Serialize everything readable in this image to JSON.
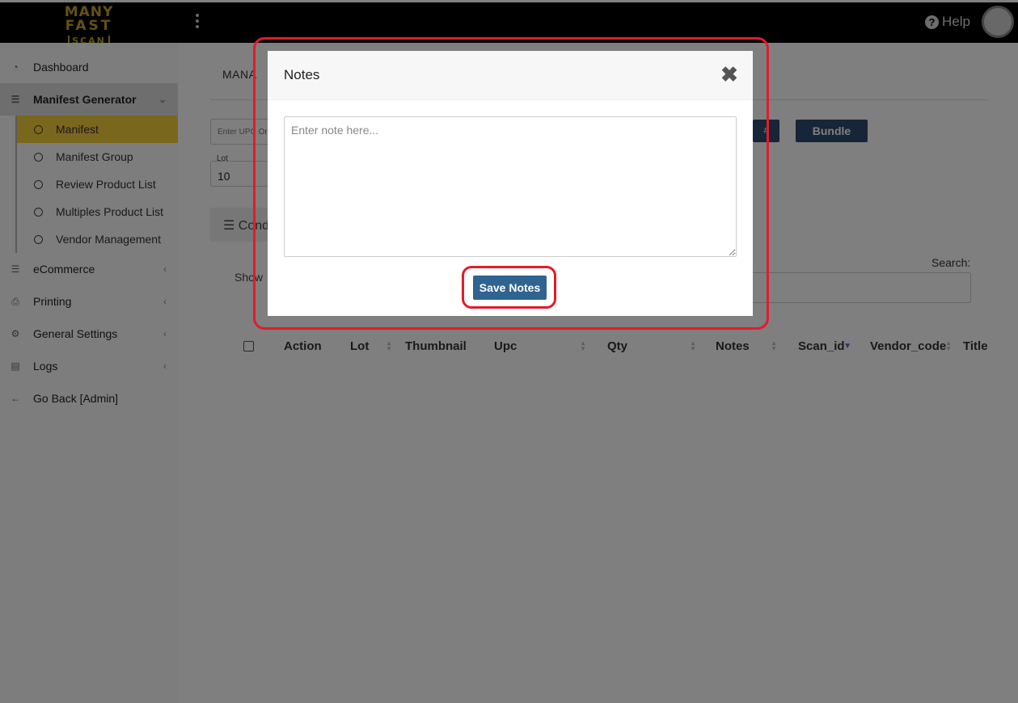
{
  "brand": {
    "line1": "MANY",
    "line2": "FAST",
    "line3": "SCAN"
  },
  "topbar": {
    "help_label": "Help"
  },
  "sidebar": {
    "items": [
      {
        "label": "Dashboard",
        "icon": "gauge-icon"
      },
      {
        "label": "Manifest Generator",
        "icon": "list-icon",
        "expanded": true
      },
      {
        "label": "eCommerce",
        "icon": "list-icon"
      },
      {
        "label": "Printing",
        "icon": "printer-icon"
      },
      {
        "label": "General Settings",
        "icon": "gears-icon"
      },
      {
        "label": "Logs",
        "icon": "layers-icon"
      },
      {
        "label": "Go Back [Admin]",
        "icon": "arrow-left-icon"
      }
    ],
    "subitems": [
      {
        "label": "Manifest",
        "active": true
      },
      {
        "label": "Manifest Group"
      },
      {
        "label": "Review Product List"
      },
      {
        "label": "Multiples Product List"
      },
      {
        "label": "Vendor Management"
      }
    ]
  },
  "main": {
    "tab_title": "MANA",
    "upc_placeholder": "Enter UPC Or",
    "lot_label": "Lot",
    "lot_value": "10",
    "hash_button": "#",
    "bundle_button": "Bundle",
    "section_title": "Cond",
    "show_label": "Show",
    "search_label": "Search:",
    "table_headers": [
      "Action",
      "Lot",
      "Thumbnail",
      "Upc",
      "Qty",
      "Notes",
      "Scan_id",
      "Vendor_code",
      "Title"
    ]
  },
  "modal": {
    "title": "Notes",
    "close_glyph": "✖",
    "textarea_placeholder": "Enter note here...",
    "save_label": "Save Notes"
  },
  "colors": {
    "topbar": "#000000",
    "active_subitem": "#f4cf3d",
    "primary_button": "#2f6391",
    "dark_button": "#2d4b6e",
    "annotation": "#e31b2a"
  }
}
